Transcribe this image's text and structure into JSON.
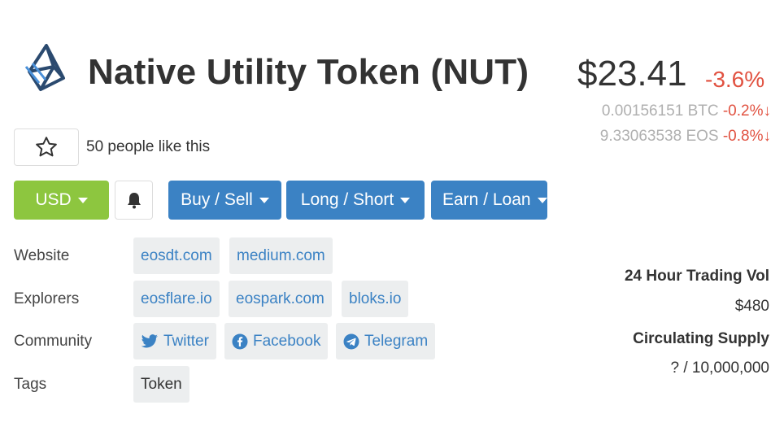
{
  "token": {
    "name": "Native Utility Token (NUT)",
    "price": "$23.41",
    "change": "-3.6%",
    "btc_price": "0.00156151 BTC",
    "btc_change": "-0.2%",
    "eos_price": "9.33063538 EOS",
    "eos_change": "-0.8%",
    "likes_text": "50 people like this"
  },
  "buttons": {
    "currency": "USD",
    "buy_sell": "Buy / Sell",
    "long_short": "Long / Short",
    "earn_loan": "Earn / Loan"
  },
  "links": {
    "website_label": "Website",
    "explorers_label": "Explorers",
    "community_label": "Community",
    "tags_label": "Tags",
    "websites": [
      "eosdt.com",
      "medium.com"
    ],
    "explorers": [
      "eosflare.io",
      "eospark.com",
      "bloks.io"
    ],
    "community": [
      "Twitter",
      "Facebook",
      "Telegram"
    ],
    "tags": [
      "Token"
    ]
  },
  "stats": {
    "volume_label": "24 Hour Trading Vol",
    "volume_value": "$480",
    "supply_label": "Circulating Supply",
    "supply_value": "? / 10,000,000"
  },
  "colors": {
    "accent_blue": "#3b82c4",
    "green": "#8dc63f",
    "negative": "#e15241",
    "chip_bg": "#eceeef"
  }
}
